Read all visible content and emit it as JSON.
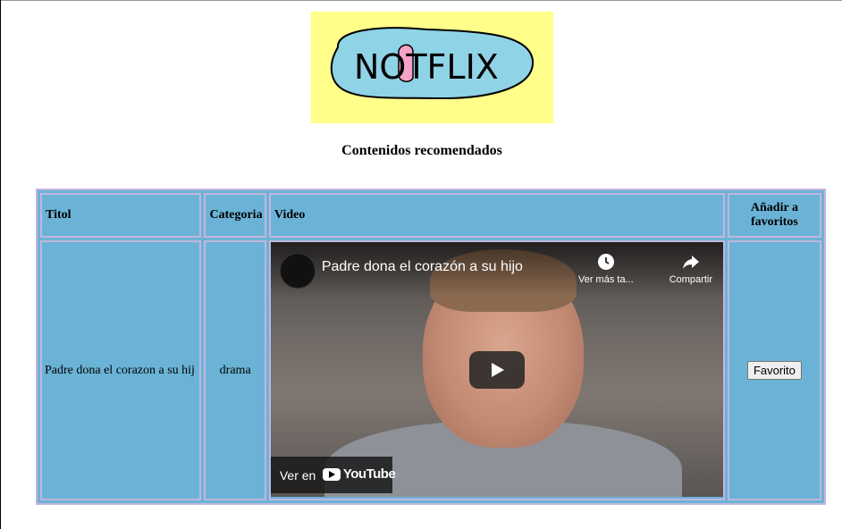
{
  "logo": {
    "text": "NOTFLIX"
  },
  "heading": "Contenidos recomendados",
  "table": {
    "headers": [
      "Titol",
      "Categoria",
      "Video",
      "Añadir a favoritos"
    ],
    "rows": [
      {
        "title": "Padre dona el corazon a su hij",
        "category": "drama",
        "video": {
          "title": "Padre dona el corazón a su hijo",
          "watch_later": "Ver más ta...",
          "share": "Compartir",
          "watch_on": "Ver en",
          "platform": "YouTube"
        },
        "favorite_button": "Favorito"
      }
    ]
  },
  "colors": {
    "table_bg": "#6bb3d6",
    "table_border": "#c2b5dd",
    "logo_bg": "#ffff8a"
  }
}
